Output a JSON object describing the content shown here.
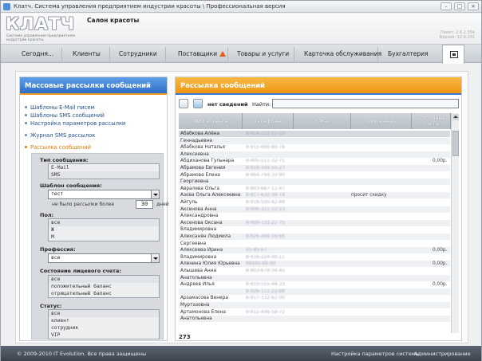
{
  "window": {
    "title": "Клатч. Система управления предприятием индустрии красоты \\ Профессиональная версия"
  },
  "header": {
    "logo_text": "КЛАТЧ",
    "logo_sub": "Система управления предприятием индустрии красоты",
    "salon": "Салон красоты",
    "version1": "Пакет: 2.6.2.354",
    "version2": "Версия: 12.0.201"
  },
  "nav": [
    {
      "label": "Сегодня..."
    },
    {
      "label": "Клиенты"
    },
    {
      "label": "Сотрудники"
    },
    {
      "label": "Поставщики"
    },
    {
      "label": "Товары и услуги"
    },
    {
      "label": "Карточка обслуживания"
    },
    {
      "label": "Бухгалтерия"
    }
  ],
  "left": {
    "title": "Массовые рассылки сообщений",
    "links": [
      {
        "label": "Шаблоны E-Mail писем"
      },
      {
        "label": "Шаблоны SMS сообщений"
      },
      {
        "label": "Настройка параметров рассылки"
      },
      {
        "label": "Журнал SMS рассылок"
      },
      {
        "label": "Рассылка сообщений"
      }
    ],
    "form": {
      "type_label": "Тип сообщения:",
      "type_options": [
        "E-Mail",
        "SMS"
      ],
      "template_label": "Шаблон сообщения:",
      "template_value": "тест",
      "days_text": "не было рассылки более",
      "days_value": "30",
      "days_unit": "дней",
      "gender_label": "Пол:",
      "gender_options": [
        "все",
        "Ж",
        "М"
      ],
      "profession_label": "Профессия:",
      "profession_value": "все",
      "account_label": "Состояние лицевого счета:",
      "account_options": [
        "все",
        "положительный баланс",
        "отрицательный баланс"
      ],
      "status_label": "Статус:",
      "status_options": [
        "все",
        "клиент",
        "сотрудник",
        "VIP"
      ]
    }
  },
  "right": {
    "title": "Рассылка сообщений",
    "toolbar": {
      "nodata": "нет сведений",
      "find_label": "Найти:",
      "find_value": ""
    },
    "columns": [
      "ФИО клиента",
      "Телефоны",
      "E-Mail",
      "Примечание",
      "Состояние счета"
    ],
    "rows": [
      {
        "name": "Абабкова Алёна",
        "phone": "8-916-222-11-33",
        "note": "",
        "balance": ""
      },
      {
        "name": "Геннадьевна",
        "phone": "",
        "note": "",
        "balance": ""
      },
      {
        "name": "Абабкова Наталья",
        "phone": "8-915-800-80-78",
        "note": "",
        "balance": ""
      },
      {
        "name": "Алексеевна",
        "phone": "",
        "note": "",
        "balance": ""
      },
      {
        "name": "Абдиханова Гульнара",
        "phone": "8-905-511-32-71",
        "note": "",
        "balance": "0,00р."
      },
      {
        "name": "Абрамова Евгения",
        "phone": "8-916-344-55-27",
        "note": "",
        "balance": ""
      },
      {
        "name": "Абрамова Елена",
        "phone": "8-964-744-33-90",
        "note": "",
        "balance": ""
      },
      {
        "name": "Георгиевна",
        "phone": "",
        "note": "",
        "balance": ""
      },
      {
        "name": "Авралева Ольга",
        "phone": "8-903-667-11-47",
        "note": "",
        "balance": ""
      },
      {
        "name": "Азова Ольга Алексеевна",
        "phone": "8-917-632-34-74",
        "note": "просит скидку",
        "balance": ""
      },
      {
        "name": "Айгуль",
        "phone": "8-916-500-42-89",
        "note": "",
        "balance": ""
      },
      {
        "name": "Аксенова Анна",
        "phone": "8-906-311-12-23",
        "note": "",
        "balance": ""
      },
      {
        "name": "Александровна",
        "phone": "",
        "note": "",
        "balance": ""
      },
      {
        "name": "Аксенова Оксана",
        "phone": "8-909-733-21-75",
        "note": "",
        "balance": ""
      },
      {
        "name": "Владимировна",
        "phone": "",
        "note": "",
        "balance": ""
      },
      {
        "name": "Алексанян Людмила",
        "phone": "8-926-404-55-66",
        "note": "",
        "balance": ""
      },
      {
        "name": "Сергеевна",
        "phone": "",
        "note": "",
        "balance": ""
      },
      {
        "name": "Алексеева Ирина",
        "phone": "45-85-67",
        "note": "",
        "balance": "0,00р."
      },
      {
        "name": "Владимировна",
        "phone": "8-916-224-00-11",
        "note": "",
        "balance": ""
      },
      {
        "name": "Аленина Юлия Юрьевна",
        "phone": "98945-88-99",
        "note": "",
        "balance": "0,00р."
      },
      {
        "name": "Алышева Анна",
        "phone": "8-903-678-34-45",
        "note": "",
        "balance": ""
      },
      {
        "name": "Анатольевна",
        "phone": "",
        "note": "",
        "balance": ""
      },
      {
        "name": "Андреев Илья",
        "phone": "8-910-555-44-33",
        "note": "",
        "balance": "0,00р."
      },
      {
        "name": "",
        "phone": "8-926-111-22-88",
        "note": "",
        "balance": ""
      },
      {
        "name": "Арзамасова Венера",
        "phone": "8-917-332-61-00",
        "note": "",
        "balance": ""
      },
      {
        "name": "Муртазовна",
        "phone": "",
        "note": "",
        "balance": ""
      },
      {
        "name": "Артамонова Елена",
        "phone": "8-912-446-58-72",
        "note": "",
        "balance": ""
      },
      {
        "name": "Анатольевна",
        "phone": "",
        "note": "",
        "balance": ""
      }
    ],
    "count": "273"
  },
  "footer": {
    "copyright": "© 2009-2010 IT Evolution. Все права защищены",
    "settings": "Настройка параметров системы",
    "admin": "Администрирование"
  }
}
